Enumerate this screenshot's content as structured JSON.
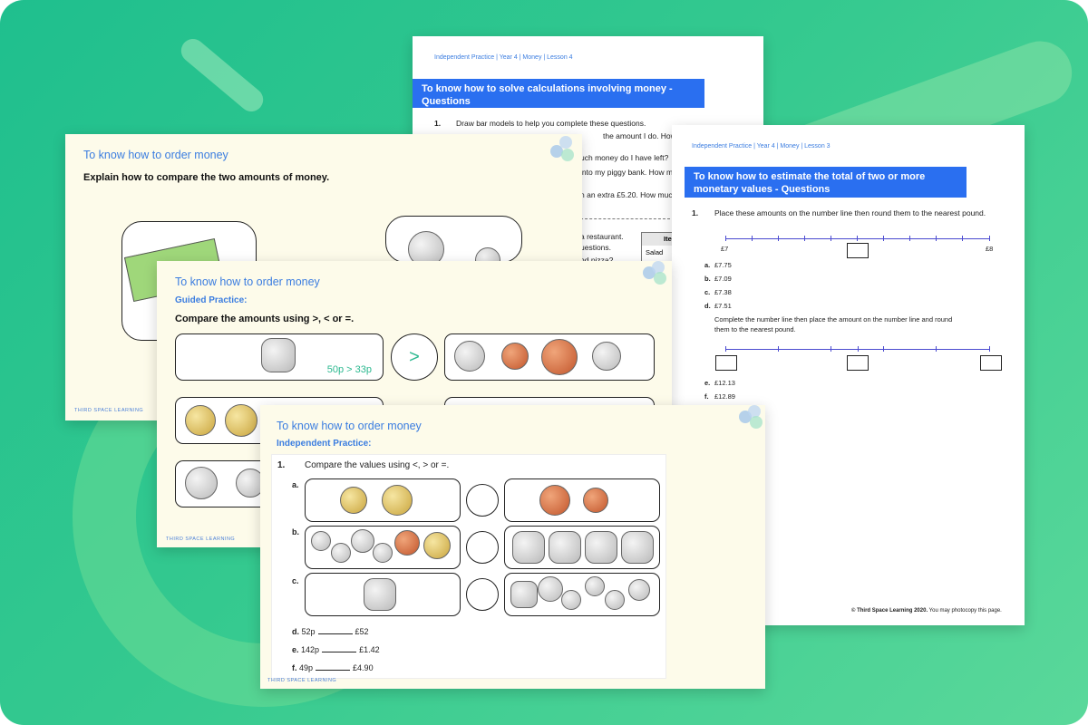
{
  "sheet_back": {
    "breadcrumb": "Independent Practice | Year 4 | Money | Lesson 4",
    "title": "To know how to solve calculations involving money - Questions",
    "q_number": "1.",
    "lines": [
      "Draw bar models to help you complete these questions.",
      "the amount I do. How much",
      "uch money do I have left?",
      "into my piggy bank. How m",
      "n an extra £5.20. How much",
      "a restaurant.",
      "uestions.",
      "nd pizza?"
    ],
    "table_header": "Ite",
    "table_cell": "Salad"
  },
  "sheet_right": {
    "breadcrumb": "Independent Practice | Year 4 | Money | Lesson 3",
    "title": "To know how to estimate the total of two or more monetary values - Questions",
    "q_number": "1.",
    "instruction": "Place these amounts on the number line then round them to the nearest pound.",
    "nl_left": "£7",
    "nl_right": "£8",
    "items": [
      {
        "letter": "a.",
        "value": "£7.75"
      },
      {
        "letter": "b.",
        "value": "£7.09"
      },
      {
        "letter": "c.",
        "value": "£7.38"
      },
      {
        "letter": "d.",
        "value": "£7.51"
      }
    ],
    "instruction2": "Complete the number line then place the amount on the number line and round",
    "instruction2b": "them to the nearest pound.",
    "items2": [
      {
        "letter": "e.",
        "value": "£12.13"
      },
      {
        "letter": "f.",
        "value": "£12.89"
      }
    ],
    "footer_bold": "© Third Space Learning 2020.",
    "footer_rest": " You may photocopy this page."
  },
  "slide_back": {
    "title": "To know how to order money",
    "question": "Explain how to compare the two amounts of money.",
    "logo": "THIRD SPACE LEARNING"
  },
  "slide_mid": {
    "title": "To know how to order money",
    "subtitle": "Guided Practice:",
    "question": "Compare the amounts using >, < or =.",
    "symbol": ">",
    "answer": "50p > 33p",
    "logo": "THIRD SPACE LEARNING"
  },
  "slide_front": {
    "title": "To know how to order money",
    "subtitle": "Independent Practice:",
    "q_number": "1.",
    "question": "Compare the values using <, > or =.",
    "rows": [
      "a.",
      "b.",
      "c."
    ],
    "items": [
      {
        "letter": "d.",
        "left": "52p",
        "right": "£52"
      },
      {
        "letter": "e.",
        "left": "142p",
        "right": "£1.42"
      },
      {
        "letter": "f.",
        "left": "49p",
        "right": "£4.90"
      }
    ],
    "logo": "THIRD SPACE LEARNING"
  },
  "colors": {
    "accent": "#2a6ff0",
    "bg_green": "#2fc78f",
    "slide_bg": "#fdfbea"
  }
}
